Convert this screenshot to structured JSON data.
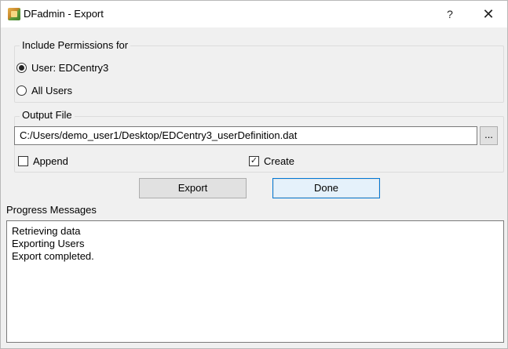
{
  "window": {
    "title": "DFadmin - Export",
    "help_label": "?",
    "close_label": "✕"
  },
  "permissions": {
    "group_title": "Include Permissions for",
    "options": [
      {
        "label": "User: EDCentry3",
        "selected": true
      },
      {
        "label": "All Users",
        "selected": false
      }
    ]
  },
  "output": {
    "group_title": "Output File",
    "path": "C:/Users/demo_user1/Desktop/EDCentry3_userDefinition.dat",
    "browse_label": "...",
    "append_label": "Append",
    "append_checked": false,
    "create_label": "Create",
    "create_checked": true
  },
  "actions": {
    "export_label": "Export",
    "done_label": "Done"
  },
  "progress": {
    "label": "Progress Messages",
    "messages": [
      "Retrieving data",
      "Exporting Users",
      "Export completed."
    ]
  },
  "icons": {
    "app": "dfadmin-app-icon",
    "check": "checkmark-icon"
  }
}
